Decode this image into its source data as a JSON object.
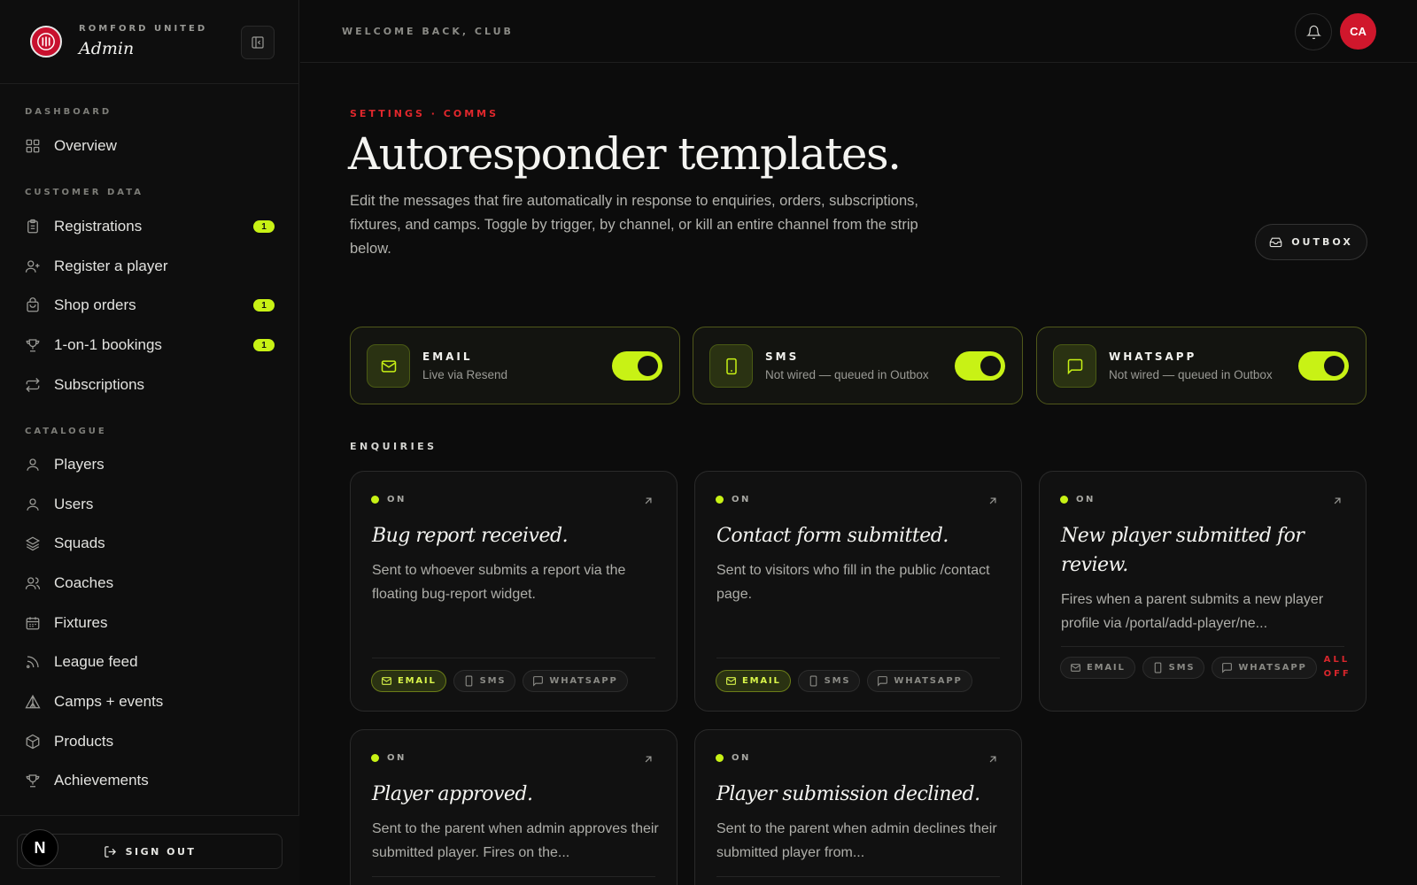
{
  "brand": {
    "club": "ROMFORD UNITED",
    "role": "Admin"
  },
  "nav": {
    "sections": [
      "DASHBOARD",
      "CUSTOMER DATA",
      "CATALOGUE"
    ],
    "items": [
      {
        "label": "Overview",
        "icon": "grid-icon"
      },
      {
        "label": "Registrations",
        "icon": "clipboard-icon",
        "badge": "1"
      },
      {
        "label": "Register a player",
        "icon": "user-plus-icon"
      },
      {
        "label": "Shop orders",
        "icon": "bag-icon",
        "badge": "1"
      },
      {
        "label": "1-on-1 bookings",
        "icon": "trophy-icon",
        "badge": "1"
      },
      {
        "label": "Subscriptions",
        "icon": "repeat-icon"
      },
      {
        "label": "Players",
        "icon": "user-icon"
      },
      {
        "label": "Users",
        "icon": "user-icon"
      },
      {
        "label": "Squads",
        "icon": "layers-icon"
      },
      {
        "label": "Coaches",
        "icon": "users-icon"
      },
      {
        "label": "Fixtures",
        "icon": "calendar-icon"
      },
      {
        "label": "League feed",
        "icon": "rss-icon"
      },
      {
        "label": "Camps + events",
        "icon": "tent-icon"
      },
      {
        "label": "Products",
        "icon": "box-icon"
      },
      {
        "label": "Achievements",
        "icon": "trophy-icon"
      }
    ],
    "sign_out": "SIGN OUT",
    "n_badge": "N"
  },
  "topbar": {
    "welcome": "WELCOME BACK, CLUB",
    "avatar_initials": "CA"
  },
  "page": {
    "eyebrow": "SETTINGS · COMMS",
    "title": "Autoresponder templates.",
    "description": "Edit the messages that fire automatically in response to enquiries, orders, subscriptions, fixtures, and camps. Toggle by trigger, by channel, or kill an entire channel from the strip below.",
    "outbox_label": "OUTBOX"
  },
  "channels": [
    {
      "name": "EMAIL",
      "status": "Live via Resend",
      "enabled": true
    },
    {
      "name": "SMS",
      "status": "Not wired — queued in Outbox",
      "enabled": true
    },
    {
      "name": "WHATSAPP",
      "status": "Not wired — queued in Outbox",
      "enabled": true
    }
  ],
  "section_label": "ENQUIRIES",
  "templates": [
    {
      "status": "ON",
      "title": "Bug report received.",
      "description": "Sent to whoever submits a report via the floating bug-report widget.",
      "chips": [
        "EMAIL",
        "SMS",
        "WHATSAPP"
      ],
      "active": "EMAIL"
    },
    {
      "status": "ON",
      "title": "Contact form submitted.",
      "description": "Sent to visitors who fill in the public /contact page.",
      "chips": [
        "EMAIL",
        "SMS",
        "WHATSAPP"
      ],
      "active": "EMAIL"
    },
    {
      "status": "ON",
      "title": "New player submitted for review.",
      "description": "Fires when a parent submits a new player profile via /portal/add-player/ne...",
      "chips": [
        "EMAIL",
        "SMS",
        "WHATSAPP"
      ],
      "active": "",
      "all_off": "ALL OFF"
    },
    {
      "status": "ON",
      "title": "Player approved.",
      "description": "Sent to the parent when admin approves their submitted player. Fires on the..."
    },
    {
      "status": "ON",
      "title": "Player submission declined.",
      "description": "Sent to the parent when admin declines their submitted player from..."
    }
  ],
  "colors": {
    "accent": "#c8f215",
    "brand_red": "#d0172c",
    "background": "#0c0c0c"
  }
}
